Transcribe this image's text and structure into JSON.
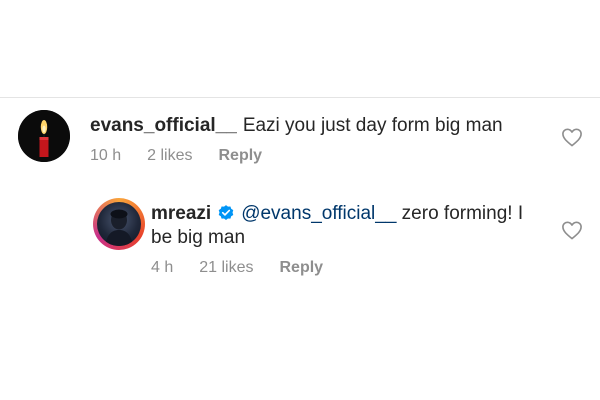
{
  "comments": [
    {
      "username": "evans_official__",
      "text": "Eazi you just day form big man",
      "time": "10 h",
      "likes": "2 likes",
      "reply_label": "Reply",
      "avatar_icon": "candle-icon"
    },
    {
      "username": "mreazi",
      "verified": true,
      "mention": "@evans_official__",
      "text": " zero forming! I be big man",
      "time": "4 h",
      "likes": "21 likes",
      "reply_label": "Reply",
      "avatar_icon": "profile-photo"
    }
  ],
  "colors": {
    "text": "#262626",
    "meta": "#8e8e8e",
    "mention": "#00376b",
    "verified": "#0095f6"
  },
  "icons": {
    "like": "heart-outline-icon"
  }
}
